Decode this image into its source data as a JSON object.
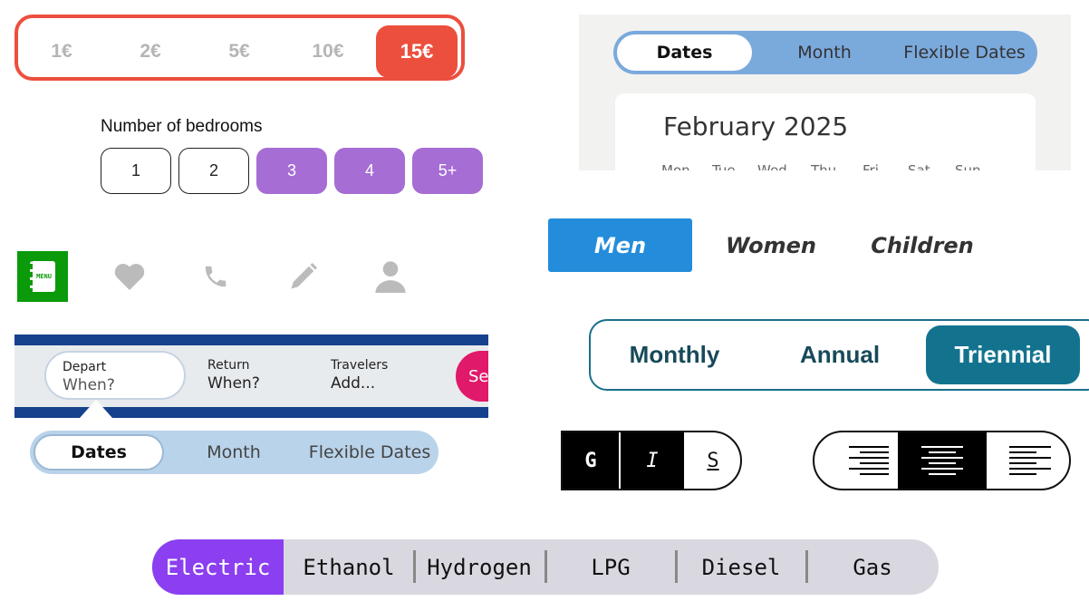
{
  "amount_selector": {
    "options": [
      "1€",
      "2€",
      "5€",
      "10€",
      "15€"
    ],
    "selected": "15€",
    "accent": "#ec4f3d"
  },
  "bedrooms": {
    "label": "Number of bedrooms",
    "options": [
      "1",
      "2",
      "3",
      "4",
      "5+"
    ],
    "selected": [
      "3",
      "4",
      "5+"
    ],
    "accent": "#a66dd4"
  },
  "icon_bar": {
    "items": [
      "menu-book-icon",
      "heart-icon",
      "phone-icon",
      "pencil-icon",
      "user-icon"
    ],
    "selected": "menu-book-icon",
    "menu_text": "MENU",
    "accent": "#0a9a0a"
  },
  "flight_search": {
    "fields": [
      {
        "label": "Depart",
        "value": "When?"
      },
      {
        "label": "Return",
        "value": "When?"
      },
      {
        "label": "Travelers",
        "value": "Add..."
      }
    ],
    "search_label": "Se"
  },
  "date_mode_small": {
    "options": [
      "Dates",
      "Month",
      "Flexible Dates"
    ],
    "selected": "Dates"
  },
  "date_picker": {
    "options": [
      "Dates",
      "Month",
      "Flexible Dates"
    ],
    "selected": "Dates",
    "month": "February 2025",
    "weekdays": [
      "Mon",
      "Tue",
      "Wed",
      "Thu",
      "Fri",
      "Sat",
      "Sun"
    ]
  },
  "gender": {
    "options": [
      "Men",
      "Women",
      "Children"
    ],
    "selected": "Men",
    "accent": "#238ddb"
  },
  "billing": {
    "options": [
      "Monthly",
      "Annual",
      "Triennial"
    ],
    "selected": "Triennial",
    "accent": "#13738f"
  },
  "text_style": {
    "options": [
      "G",
      "I",
      "S"
    ],
    "selected": [
      "G",
      "I"
    ]
  },
  "text_align": {
    "options": [
      "align-right-icon",
      "align-center-icon",
      "align-left-icon"
    ],
    "selected": "align-center-icon"
  },
  "fuel": {
    "options": [
      "Electric",
      "Ethanol",
      "Hydrogen",
      "LPG",
      "Diesel",
      "Gas"
    ],
    "selected": "Electric",
    "accent": "#8b3ff0"
  }
}
